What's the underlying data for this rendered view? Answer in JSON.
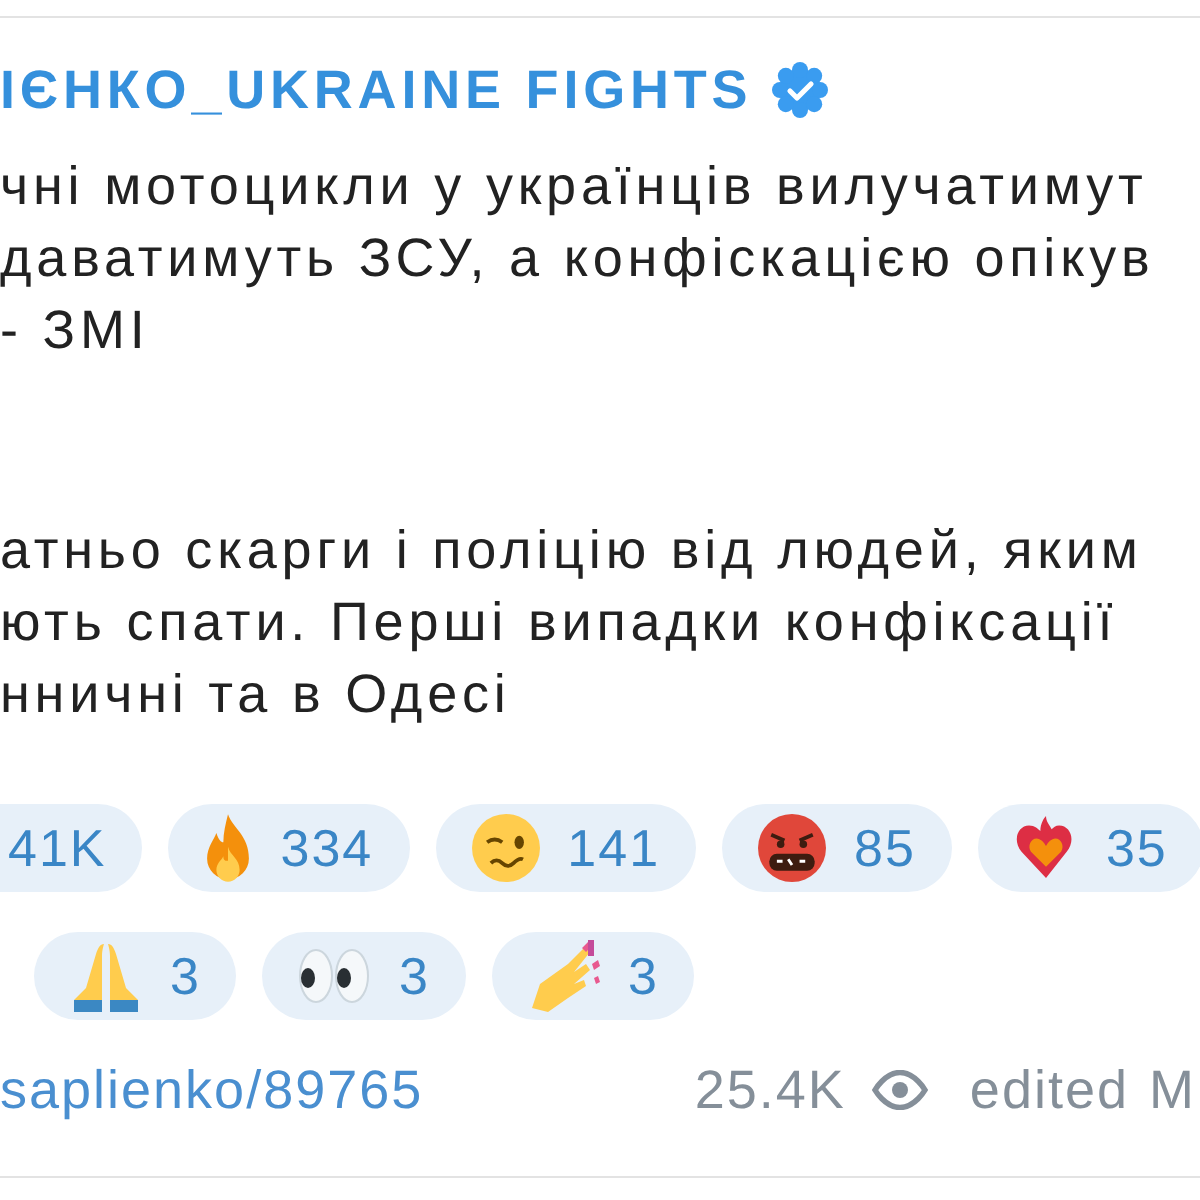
{
  "channel": {
    "name": "ІЄНКО_UKRAINE FIGHTS",
    "verified": true
  },
  "post": {
    "paragraphs": [
      {
        "lines": [
          "чні мотоцикли у українців вилучатимут",
          "даватимуть ЗСУ, а конфіскацією опікув",
          "- ЗМІ"
        ]
      },
      {
        "lines": [
          "атньо скарги і поліцію від людей, яким",
          "ють спати. Перші випадки конфіксації",
          "нничні та в Одесі"
        ]
      }
    ]
  },
  "reaction_rows": [
    [
      {
        "count": "41K",
        "selected": false
      },
      {
        "kind": "fire",
        "count": "334",
        "selected": false
      },
      {
        "kind": "woozy",
        "count": "141",
        "selected": false
      },
      {
        "kind": "cursing",
        "count": "85",
        "selected": false
      },
      {
        "kind": "heart_fire",
        "count": "35",
        "selected": false
      }
    ],
    [
      {
        "kind": "pray",
        "count": "3",
        "selected": false
      },
      {
        "kind": "eyes",
        "count": "3",
        "selected": false
      },
      {
        "kind": "nails",
        "count": "3",
        "selected": false
      }
    ]
  ],
  "footer": {
    "link": "saplienko/89765",
    "views": "25.4K",
    "edited": "edited",
    "time": "M"
  }
}
